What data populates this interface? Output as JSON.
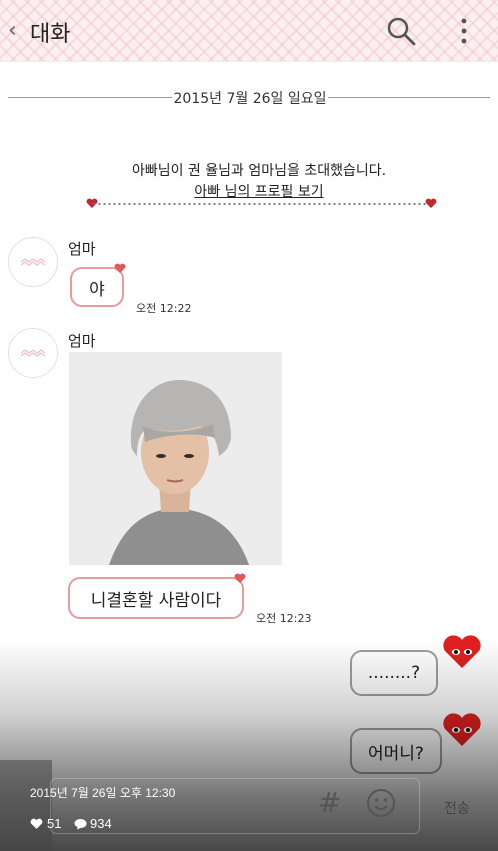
{
  "topbar": {
    "back_icon": "chevron-left-icon",
    "title": "대화",
    "search_icon": "search-icon",
    "more_icon": "more-vertical-icon"
  },
  "date_divider": "2015년 7월 26일 일요일",
  "notice": {
    "text": "아빠님이 권 율님과 엄마님을 초대했습니다.",
    "link": "아빠 님의 프로필 보기"
  },
  "messages": [
    {
      "sender": "엄마",
      "text": "야",
      "time": "오전 12:22"
    },
    {
      "sender": "엄마",
      "photo": "portrait-photo"
    },
    {
      "text": "니결혼할 사람이다",
      "time": "오전 12:23"
    }
  ],
  "my_messages": [
    {
      "text": "........?"
    },
    {
      "text": "어머니?"
    }
  ],
  "input": {
    "hash_icon": "#",
    "emoji_icon": "smiley-icon",
    "send_label": "전송"
  },
  "post": {
    "date": "2015년 7월 26일 오후 12:30",
    "likes": "51",
    "comments": "934"
  },
  "colors": {
    "bubble_border": "#e79b9b",
    "my_bubble_border": "#9e9e9e",
    "heart_red": "#e02020"
  }
}
